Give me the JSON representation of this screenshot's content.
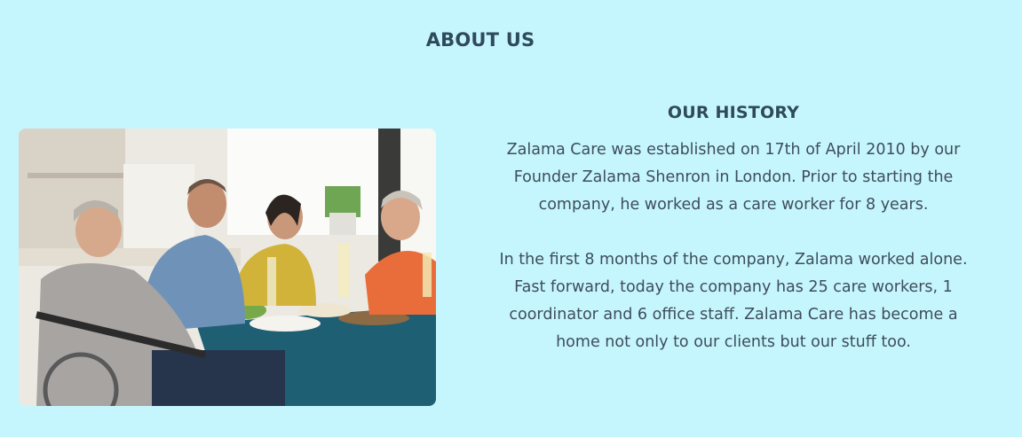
{
  "about": {
    "title": "ABOUT US"
  },
  "history": {
    "heading": "OUR HISTORY",
    "paragraphs": [
      "Zalama Care was established on 17th of April 2010 by our Founder Zalama Shenron in London. Prior to starting the company, he worked as a care worker for 8 years.",
      "In the first 8 months of the company, Zalama worked alone. Fast forward, today the company has 25 care workers, 1 coordinator and 6 office staff. Zalama Care has become a home not only to our clients but our stuff too."
    ]
  },
  "photo": {
    "icon": "family-dinner-photo"
  },
  "colors": {
    "background": "#c6f6fd",
    "heading": "#2f4a5a",
    "body_text": "#3d4d5c"
  }
}
